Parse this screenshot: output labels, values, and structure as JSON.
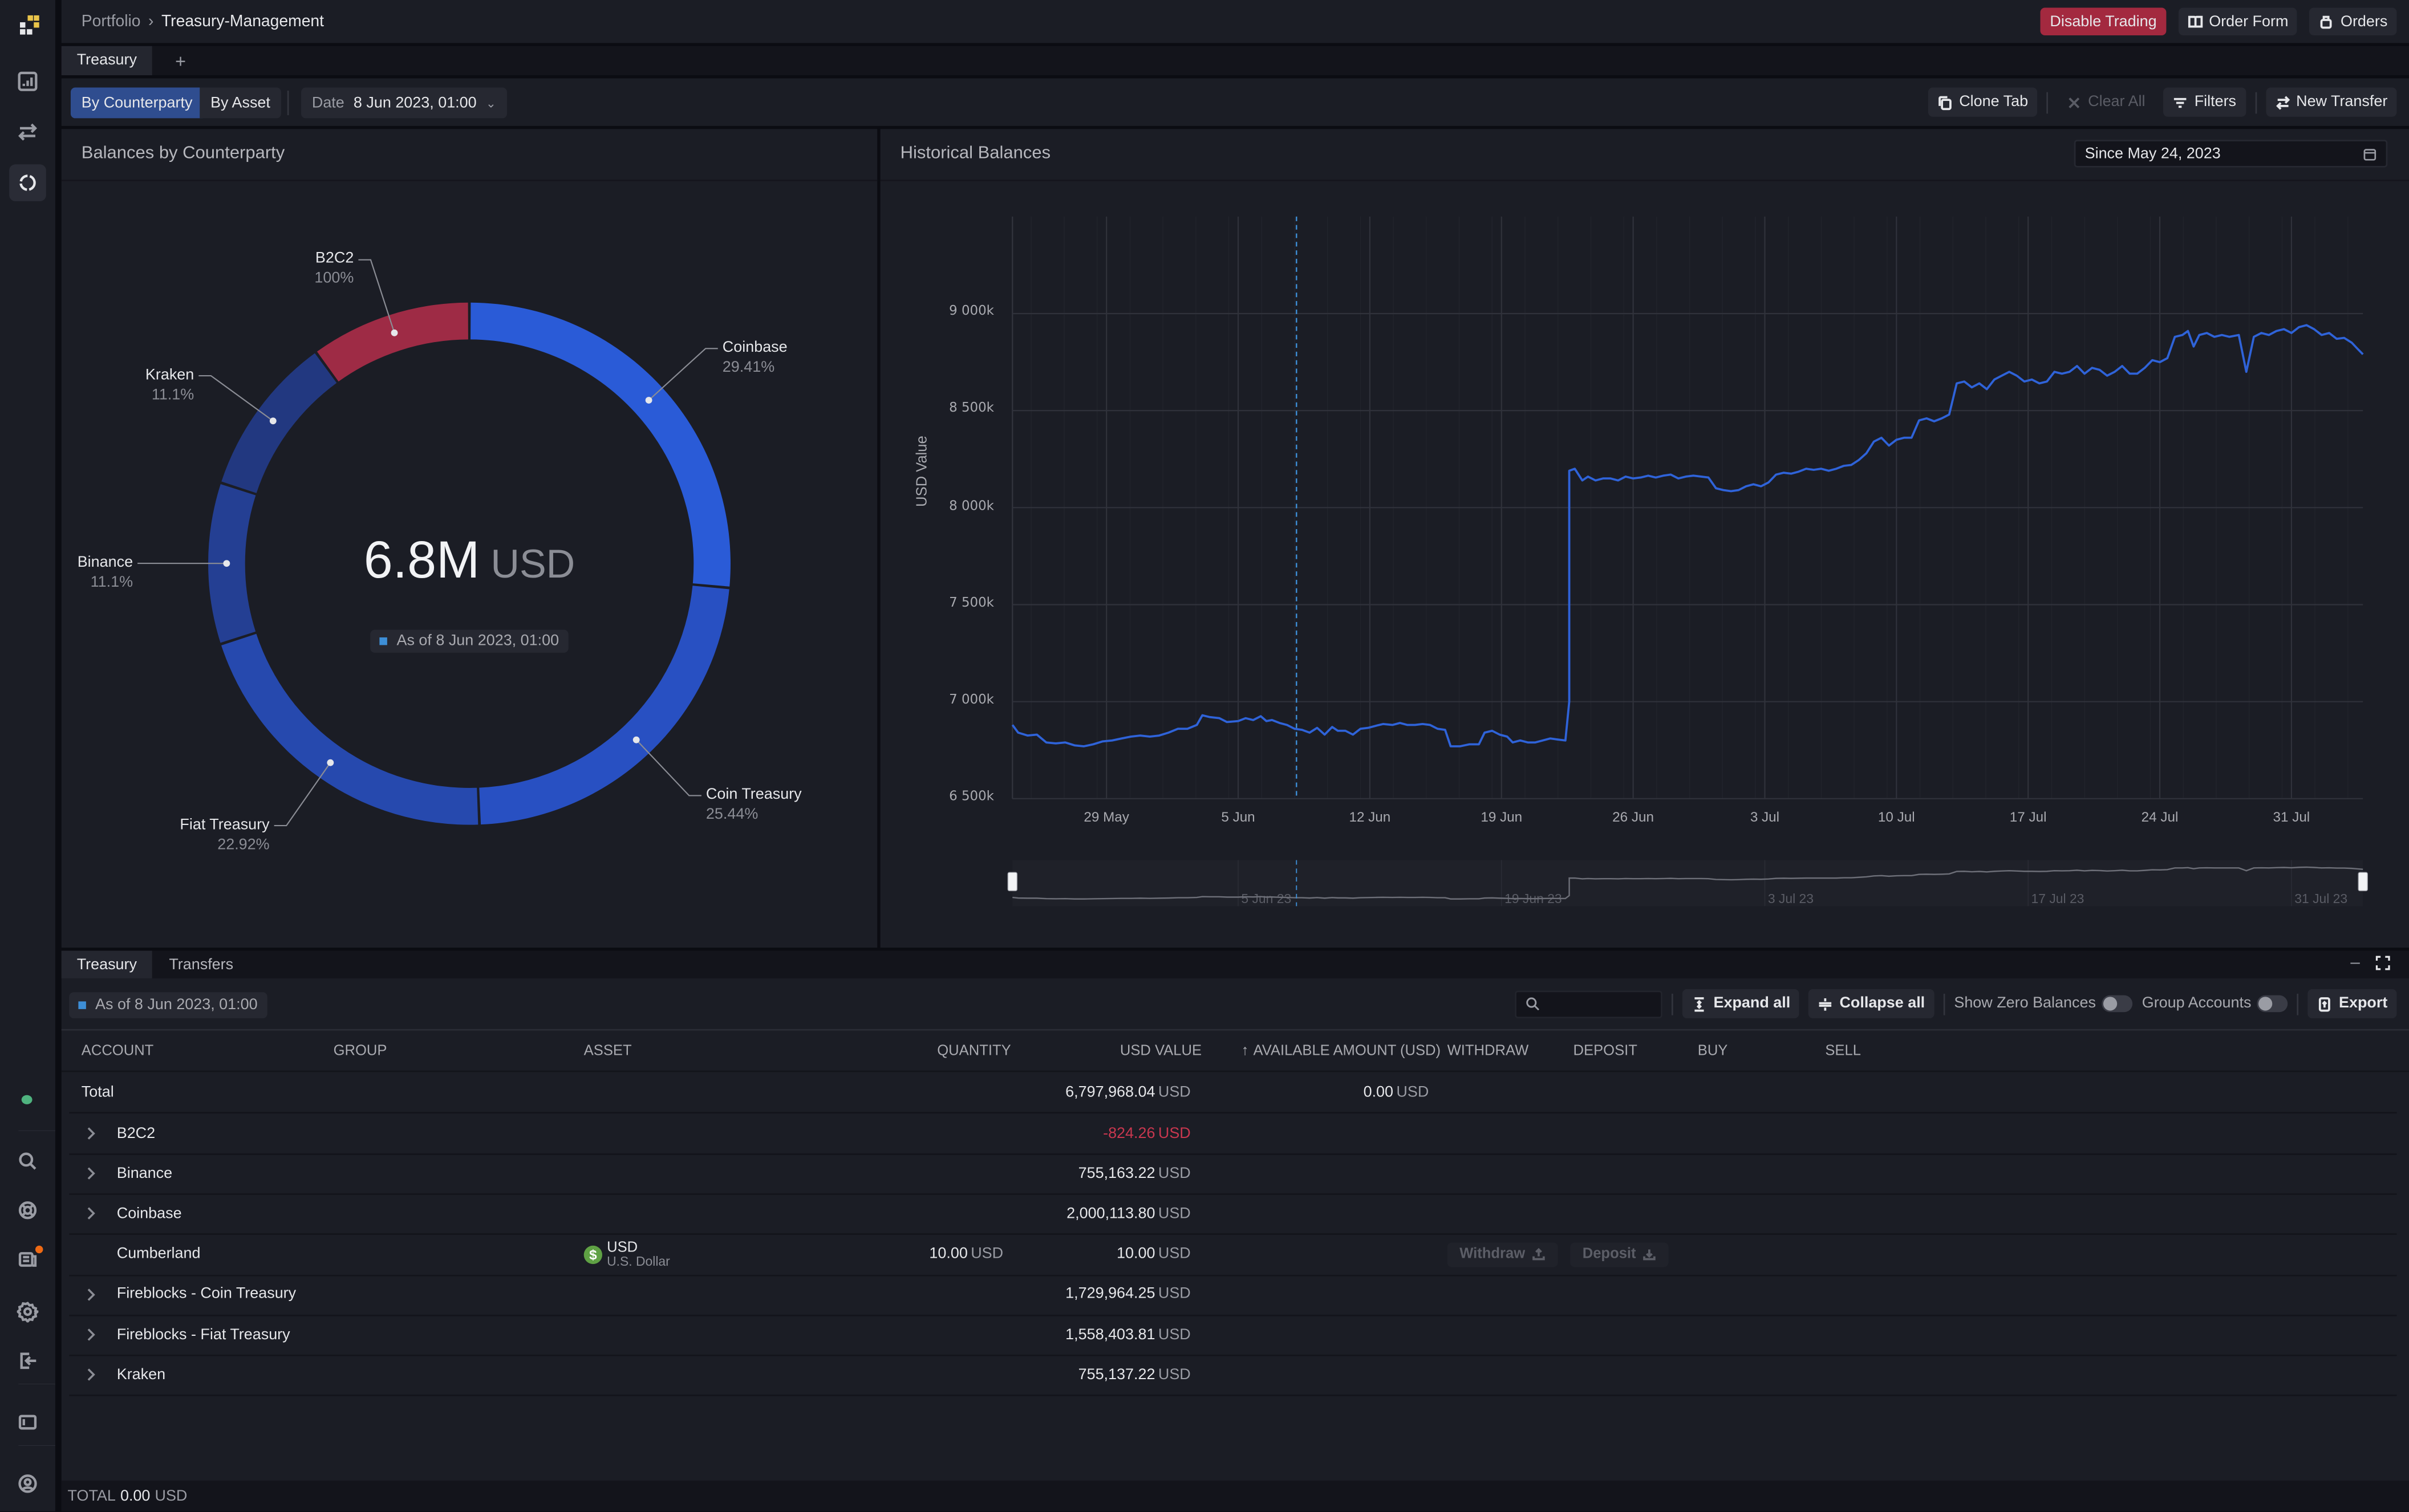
{
  "app": {
    "breadcrumb": [
      "Portfolio",
      "Treasury-Management"
    ],
    "top_buttons": {
      "disable_trading": "Disable Trading",
      "order_form": "Order Form",
      "orders": "Orders"
    },
    "tabs": [
      {
        "label": "Treasury",
        "active": true
      }
    ],
    "add_tab": "+"
  },
  "toolbar": {
    "view_modes": [
      {
        "label": "By Counterparty",
        "active": true
      },
      {
        "label": "By Asset",
        "active": false
      }
    ],
    "date_label": "Date",
    "date_value": "8 Jun 2023, 01:00",
    "clone_tab": "Clone Tab",
    "clear_all": "Clear All",
    "filters": "Filters",
    "new_transfer": "New Transfer"
  },
  "donut_panel": {
    "title": "Balances by Counterparty",
    "center_value": "6.8M",
    "center_unit": "USD",
    "as_of": "As of 8 Jun 2023, 01:00"
  },
  "chart_panel": {
    "title": "Historical Balances",
    "since": "Since May 24, 2023"
  },
  "chart_data": [
    {
      "type": "pie",
      "title": "Balances by Counterparty",
      "center_text": "6.8M USD",
      "slices": [
        {
          "label": "Coinbase",
          "pct_label": "29.41%",
          "share": 29.41,
          "color": "#2a5bd7"
        },
        {
          "label": "Coin Treasury",
          "pct_label": "25.44%",
          "share": 25.44,
          "color": "#2850c2"
        },
        {
          "label": "Fiat Treasury",
          "pct_label": "22.92%",
          "share": 22.92,
          "color": "#2649ae"
        },
        {
          "label": "Binance",
          "pct_label": "11.1%",
          "share": 11.1,
          "color": "#243f93"
        },
        {
          "label": "Kraken",
          "pct_label": "11.1%",
          "share": 11.1,
          "color": "#223880"
        },
        {
          "label": "B2C2",
          "pct_label": "100%",
          "share": 11.1,
          "color": "#9e2b45"
        }
      ]
    },
    {
      "type": "line",
      "title": "Historical Balances",
      "xlabel": "",
      "ylabel": "USD Value",
      "ylim": [
        6500,
        9500
      ],
      "y_unit": "k USD",
      "y_ticks": [
        {
          "value": 6500,
          "label": "6 500k"
        },
        {
          "value": 7000,
          "label": "7 000k"
        },
        {
          "value": 7500,
          "label": "7 500k"
        },
        {
          "value": 8000,
          "label": "8 000k"
        },
        {
          "value": 8500,
          "label": "8 500k"
        },
        {
          "value": 9000,
          "label": "9 000k"
        }
      ],
      "x_range_days": [
        0,
        71.8
      ],
      "x_origin": "2023-05-24",
      "x_ticks": [
        {
          "day": 5,
          "label": "29 May"
        },
        {
          "day": 12,
          "label": "5 Jun"
        },
        {
          "day": 19,
          "label": "12 Jun"
        },
        {
          "day": 26,
          "label": "19 Jun"
        },
        {
          "day": 33,
          "label": "26 Jun"
        },
        {
          "day": 40,
          "label": "3 Jul"
        },
        {
          "day": 47,
          "label": "10 Jul"
        },
        {
          "day": 54,
          "label": "17 Jul"
        },
        {
          "day": 61,
          "label": "24 Jul"
        },
        {
          "day": 68,
          "label": "31 Jul"
        }
      ],
      "marker_day": 15.1,
      "grid": true,
      "series": [
        {
          "name": "USD Value",
          "color": "#2f63d9",
          "points": [
            [
              0,
              6880
            ],
            [
              0.3,
              6840
            ],
            [
              0.8,
              6825
            ],
            [
              1.3,
              6830
            ],
            [
              1.8,
              6790
            ],
            [
              2.3,
              6785
            ],
            [
              2.8,
              6790
            ],
            [
              3.3,
              6775
            ],
            [
              3.8,
              6770
            ],
            [
              4.3,
              6780
            ],
            [
              4.8,
              6795
            ],
            [
              5.3,
              6800
            ],
            [
              5.8,
              6810
            ],
            [
              6.3,
              6820
            ],
            [
              6.8,
              6825
            ],
            [
              7.3,
              6820
            ],
            [
              7.8,
              6825
            ],
            [
              8.3,
              6840
            ],
            [
              8.8,
              6860
            ],
            [
              9.3,
              6860
            ],
            [
              9.8,
              6880
            ],
            [
              10.1,
              6930
            ],
            [
              10.5,
              6920
            ],
            [
              11,
              6915
            ],
            [
              11.4,
              6895
            ],
            [
              12,
              6900
            ],
            [
              12.4,
              6915
            ],
            [
              12.8,
              6905
            ],
            [
              13.2,
              6925
            ],
            [
              13.5,
              6900
            ],
            [
              13.8,
              6905
            ],
            [
              14.2,
              6890
            ],
            [
              14.6,
              6880
            ],
            [
              15,
              6860
            ],
            [
              15.4,
              6855
            ],
            [
              15.8,
              6840
            ],
            [
              16.2,
              6865
            ],
            [
              16.6,
              6830
            ],
            [
              17,
              6870
            ],
            [
              17.3,
              6850
            ],
            [
              17.7,
              6850
            ],
            [
              18.1,
              6830
            ],
            [
              18.5,
              6860
            ],
            [
              18.9,
              6865
            ],
            [
              19.3,
              6875
            ],
            [
              19.7,
              6885
            ],
            [
              20.2,
              6880
            ],
            [
              20.6,
              6890
            ],
            [
              21,
              6880
            ],
            [
              21.4,
              6880
            ],
            [
              21.8,
              6885
            ],
            [
              22.2,
              6880
            ],
            [
              22.6,
              6860
            ],
            [
              23,
              6855
            ],
            [
              23.3,
              6770
            ],
            [
              23.8,
              6770
            ],
            [
              24.3,
              6780
            ],
            [
              24.8,
              6780
            ],
            [
              25.1,
              6840
            ],
            [
              25.5,
              6850
            ],
            [
              25.9,
              6830
            ],
            [
              26.3,
              6820
            ],
            [
              26.6,
              6790
            ],
            [
              27,
              6800
            ],
            [
              27.4,
              6790
            ],
            [
              27.8,
              6790
            ],
            [
              28.2,
              6800
            ],
            [
              28.6,
              6810
            ],
            [
              29,
              6805
            ],
            [
              29.4,
              6800
            ],
            [
              29.6,
              7000
            ],
            [
              29.6,
              8190
            ],
            [
              29.9,
              8200
            ],
            [
              30.3,
              8140
            ],
            [
              30.6,
              8160
            ],
            [
              31,
              8140
            ],
            [
              31.4,
              8150
            ],
            [
              31.8,
              8150
            ],
            [
              32.2,
              8140
            ],
            [
              32.6,
              8160
            ],
            [
              33,
              8150
            ],
            [
              33.4,
              8155
            ],
            [
              33.8,
              8165
            ],
            [
              34.2,
              8155
            ],
            [
              34.6,
              8165
            ],
            [
              35,
              8170
            ],
            [
              35.4,
              8150
            ],
            [
              35.8,
              8160
            ],
            [
              36.2,
              8165
            ],
            [
              36.6,
              8160
            ],
            [
              37,
              8155
            ],
            [
              37.4,
              8100
            ],
            [
              37.8,
              8090
            ],
            [
              38.2,
              8085
            ],
            [
              38.6,
              8090
            ],
            [
              39,
              8110
            ],
            [
              39.4,
              8120
            ],
            [
              39.8,
              8110
            ],
            [
              40.2,
              8130
            ],
            [
              40.6,
              8170
            ],
            [
              41,
              8180
            ],
            [
              41.4,
              8175
            ],
            [
              41.8,
              8185
            ],
            [
              42.2,
              8200
            ],
            [
              42.6,
              8195
            ],
            [
              43,
              8200
            ],
            [
              43.4,
              8190
            ],
            [
              43.8,
              8200
            ],
            [
              44.2,
              8215
            ],
            [
              44.6,
              8220
            ],
            [
              45,
              8245
            ],
            [
              45.4,
              8280
            ],
            [
              45.8,
              8340
            ],
            [
              46.2,
              8360
            ],
            [
              46.6,
              8320
            ],
            [
              47,
              8350
            ],
            [
              47.4,
              8360
            ],
            [
              47.8,
              8360
            ],
            [
              48.2,
              8450
            ],
            [
              48.6,
              8460
            ],
            [
              49,
              8445
            ],
            [
              49.4,
              8460
            ],
            [
              49.8,
              8480
            ],
            [
              50.2,
              8640
            ],
            [
              50.6,
              8650
            ],
            [
              51,
              8620
            ],
            [
              51.4,
              8640
            ],
            [
              51.8,
              8610
            ],
            [
              52.2,
              8660
            ],
            [
              52.6,
              8680
            ],
            [
              53,
              8700
            ],
            [
              53.4,
              8680
            ],
            [
              53.8,
              8650
            ],
            [
              54.2,
              8660
            ],
            [
              54.6,
              8640
            ],
            [
              55,
              8650
            ],
            [
              55.4,
              8700
            ],
            [
              55.8,
              8690
            ],
            [
              56.2,
              8700
            ],
            [
              56.6,
              8730
            ],
            [
              57,
              8690
            ],
            [
              57.4,
              8720
            ],
            [
              57.8,
              8710
            ],
            [
              58.2,
              8680
            ],
            [
              58.6,
              8700
            ],
            [
              59,
              8730
            ],
            [
              59.4,
              8690
            ],
            [
              59.8,
              8690
            ],
            [
              60.2,
              8720
            ],
            [
              60.6,
              8760
            ],
            [
              61,
              8750
            ],
            [
              61.4,
              8770
            ],
            [
              61.8,
              8880
            ],
            [
              62.2,
              8890
            ],
            [
              62.5,
              8910
            ],
            [
              62.8,
              8830
            ],
            [
              63.1,
              8890
            ],
            [
              63.5,
              8900
            ],
            [
              63.9,
              8880
            ],
            [
              64.3,
              8890
            ],
            [
              64.7,
              8880
            ],
            [
              65.2,
              8890
            ],
            [
              65.6,
              8700
            ],
            [
              66,
              8880
            ],
            [
              66.4,
              8900
            ],
            [
              66.8,
              8890
            ],
            [
              67.2,
              8910
            ],
            [
              67.6,
              8920
            ],
            [
              68,
              8900
            ],
            [
              68.4,
              8930
            ],
            [
              68.8,
              8940
            ],
            [
              69.2,
              8920
            ],
            [
              69.6,
              8890
            ],
            [
              70,
              8900
            ],
            [
              70.4,
              8870
            ],
            [
              70.8,
              8875
            ],
            [
              71.2,
              8850
            ],
            [
              71.5,
              8820
            ],
            [
              71.8,
              8790
            ]
          ]
        }
      ]
    }
  ],
  "bottom": {
    "tabs": [
      {
        "label": "Treasury",
        "active": true
      },
      {
        "label": "Transfers",
        "active": false
      }
    ],
    "as_of": "As of 8 Jun 2023, 01:00",
    "search_placeholder": "",
    "expand_all": "Expand all",
    "collapse_all": "Collapse all",
    "show_zero_balances": "Show Zero Balances",
    "group_accounts": "Group Accounts",
    "export": "Export",
    "columns": {
      "account": "ACCOUNT",
      "group": "GROUP",
      "asset": "ASSET",
      "quantity": "QUANTITY",
      "usd_value": "USD VALUE",
      "available": "AVAILABLE AMOUNT (USD)",
      "withdraw": "WITHDRAW",
      "deposit": "DEPOSIT",
      "buy": "BUY",
      "sell": "SELL"
    },
    "total_row": {
      "label": "Total",
      "usd_value": "6,797,968.04",
      "usd_unit": "USD",
      "available": "0.00",
      "available_unit": "USD"
    },
    "rows": [
      {
        "account": "B2C2",
        "expandable": true,
        "usd_value": "-824.26",
        "unit": "USD",
        "negative": true
      },
      {
        "account": "Binance",
        "expandable": true,
        "usd_value": "755,163.22",
        "unit": "USD"
      },
      {
        "account": "Coinbase",
        "expandable": true,
        "usd_value": "2,000,113.80",
        "unit": "USD"
      },
      {
        "account": "Cumberland",
        "expandable": false,
        "asset_code": "USD",
        "asset_name": "U.S. Dollar",
        "quantity": "10.00",
        "quantity_unit": "USD",
        "usd_value": "10.00",
        "unit": "USD",
        "withdraw": "Withdraw",
        "deposit": "Deposit"
      },
      {
        "account": "Fireblocks - Coin Treasury",
        "expandable": true,
        "usd_value": "1,729,964.25",
        "unit": "USD"
      },
      {
        "account": "Fireblocks - Fiat Treasury",
        "expandable": true,
        "usd_value": "1,558,403.81",
        "unit": "USD"
      },
      {
        "account": "Kraken",
        "expandable": true,
        "usd_value": "755,137.22",
        "unit": "USD"
      }
    ],
    "footer": {
      "label": "TOTAL",
      "value": "0.00",
      "unit": "USD"
    }
  }
}
